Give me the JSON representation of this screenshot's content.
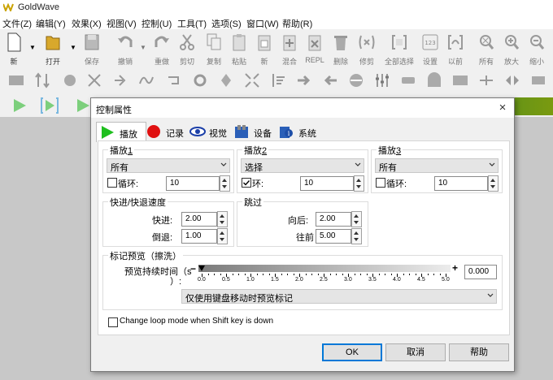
{
  "app": {
    "title": "GoldWave"
  },
  "menu": [
    "文件(Z)",
    "编辑(Y)",
    "效果(X)",
    "视图(V)",
    "控制(U)",
    "工具(T)",
    "选项(S)",
    "窗口(W)",
    "帮助(R)"
  ],
  "toolbar": {
    "new": "新",
    "open": "打开",
    "save": "保存",
    "undo": "撤销",
    "redo": "重做",
    "cut": "剪切",
    "copy": "复制",
    "paste": "粘贴",
    "paste_new": "新",
    "mix": "混合",
    "replace": "REPL",
    "delete": "删除",
    "trim": "修剪",
    "select_all": "全部选择",
    "set": "设置",
    "previous": "以前",
    "all": "所有",
    "zoom_in": "放大",
    "zoom_out": "缩小"
  },
  "dialog": {
    "title": "控制属性",
    "close": "×",
    "tabs": {
      "play": "播放",
      "record": "记录",
      "visual": "视觉",
      "devices": "设备",
      "system": "系统"
    },
    "play1": {
      "title": "播放",
      "title_num": "1",
      "value": "所有",
      "loop_label": "循环:",
      "loop_value": "10",
      "loop_checked": false
    },
    "play2": {
      "title": "播放",
      "title_num": "2",
      "value": "选择",
      "loop_label": "环:",
      "loop_value": "10",
      "loop_checked": true
    },
    "play3": {
      "title": "播放",
      "title_num": "3",
      "value": "所有",
      "loop_label": "循环:",
      "loop_value": "10",
      "loop_checked": false
    },
    "speed": {
      "title": "快进/快退速度",
      "forward_label": "快进:",
      "forward_value": "2.00",
      "rewind_label": "倒退:",
      "rewind_value": "1.00"
    },
    "skip": {
      "title": "跳过",
      "back_label": "向后:",
      "back_value": "2.00",
      "forward_label": "往前",
      "forward_value": "5.00"
    },
    "cue": {
      "title": "标记预览（擦洗）",
      "duration_label_1": "预览持续时间（s",
      "duration_label_2": "）:",
      "minus": "−",
      "plus": "+",
      "value": "0.000",
      "slider_fraction": 0.0,
      "ticks": [
        "0.0",
        "0.5",
        "1.0",
        "1.5",
        "2.0",
        "2.5",
        "3.0",
        "3.5",
        "4.0",
        "4.5",
        "5.0"
      ],
      "mode": "仅使用键盘移动时预览标记"
    },
    "shift_loop": {
      "label": "Change loop mode when Shift key is down",
      "checked": false
    },
    "buttons": {
      "ok": "OK",
      "cancel": "取消",
      "help": "帮助"
    }
  }
}
